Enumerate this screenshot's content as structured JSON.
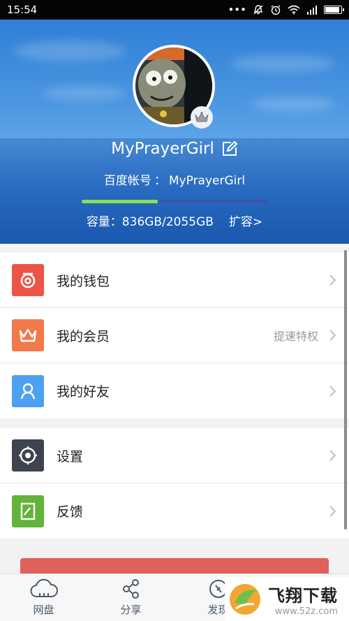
{
  "status_bar": {
    "time": "15:54",
    "icons": [
      "dots-icon",
      "mute-icon",
      "alarm-icon",
      "wifi-icon",
      "signal-icon",
      "battery-icon"
    ]
  },
  "profile": {
    "username": "MyPrayerGirl",
    "account_label": "百度帐号",
    "account_separator": "：",
    "account_value": "MyPrayerGirl",
    "quota_label": "容量：836GB/2055GB",
    "quota_fraction": 0.41,
    "expand_label": "扩容>"
  },
  "menu_group_1": [
    {
      "label": "我的钱包",
      "extra": "",
      "icon": "wallet-icon",
      "color": "#ec5447"
    },
    {
      "label": "我的会员",
      "extra": "提速特权",
      "icon": "crown-icon",
      "color": "#f1794a"
    },
    {
      "label": "我的好友",
      "extra": "",
      "icon": "friends-icon",
      "color": "#4ea0f0"
    }
  ],
  "menu_group_2": [
    {
      "label": "设置",
      "extra": "",
      "icon": "gear-icon",
      "color": "#3f434f"
    },
    {
      "label": "反馈",
      "extra": "",
      "icon": "feedback-icon",
      "color": "#62b33a"
    }
  ],
  "tabs": [
    {
      "label": "网盘",
      "icon": "cloud-icon"
    },
    {
      "label": "分享",
      "icon": "share-icon"
    },
    {
      "label": "发现",
      "icon": "compass-icon"
    }
  ],
  "watermark": {
    "title": "飞翔下载",
    "url": "www.52z.com"
  },
  "colors": {
    "logout_button": "#e0605b",
    "quota_fill": "#8be04f",
    "header": "#3e8bdc"
  }
}
